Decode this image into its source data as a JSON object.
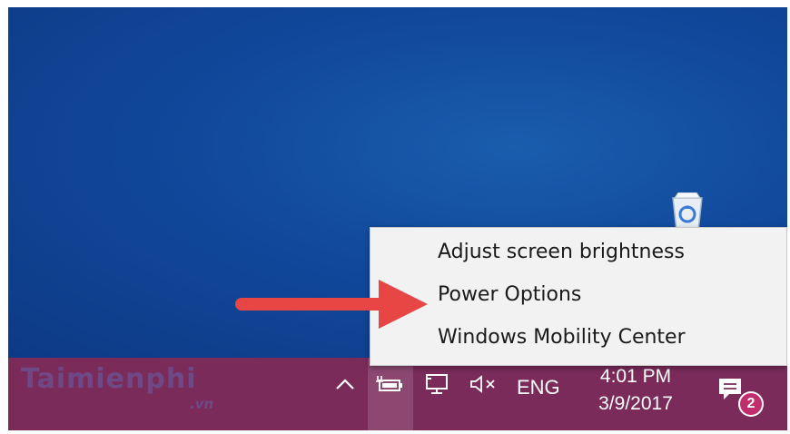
{
  "desktop": {
    "background_color": "#11489b",
    "recycle_bin_icon": "recycle-bin-icon"
  },
  "context_menu": {
    "items": [
      {
        "label": "Adjust screen brightness"
      },
      {
        "label": "Power Options"
      },
      {
        "label": "Windows Mobility Center"
      }
    ]
  },
  "annotation": {
    "arrow_color": "#e84545",
    "arrow_icon": "red-arrow-pointer"
  },
  "taskbar": {
    "background_color": "#7a2b5a",
    "watermark": "Taimienphi",
    "watermark_sub": ".vn",
    "tray": {
      "show_hidden_icon": "chevron-up-icon",
      "battery_icon": "battery-charging-icon",
      "network_icon": "network-icon",
      "volume_icon": "volume-muted-icon",
      "language": "ENG",
      "time": "4:01 PM",
      "date": "3/9/2017",
      "notification_icon": "action-center-icon",
      "notification_count": "2"
    }
  }
}
